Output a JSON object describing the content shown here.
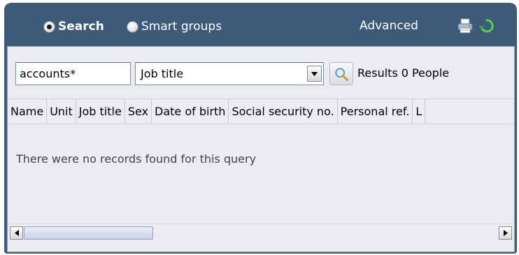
{
  "header": {
    "search_label": "Search",
    "smart_groups_label": "Smart groups",
    "advanced_label": "Advanced",
    "icons": [
      "print-icon",
      "refresh-icon"
    ]
  },
  "search": {
    "input_value": "accounts*",
    "field_select_value": "Job title",
    "results_label": "Results",
    "results_count": "0",
    "results_unit": "People"
  },
  "table": {
    "columns": [
      "Name",
      "Unit",
      "Job title",
      "Sex",
      "Date of birth",
      "Social security no.",
      "Personal ref.",
      "L"
    ],
    "empty_message": "There were no records found for this query"
  },
  "colors": {
    "header_bg": "#3d5a79",
    "content_bg": "#ebebf0",
    "refresh_green": "#3aa43a"
  }
}
